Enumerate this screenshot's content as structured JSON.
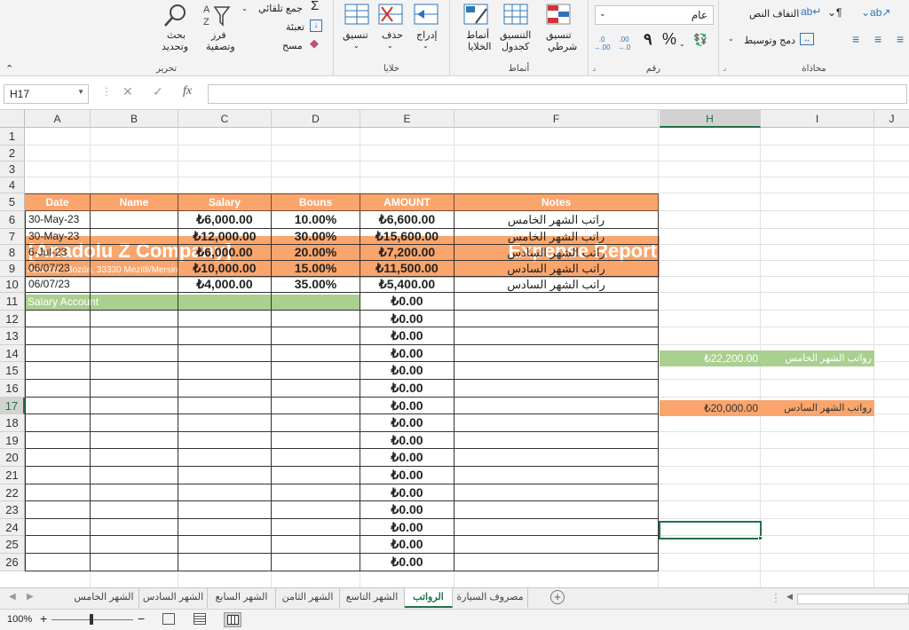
{
  "ribbon": {
    "editing": {
      "title": "تحرير",
      "autosum": "جمع تلقائي",
      "fill": "تعبئة",
      "clear": "مسح",
      "sort_filter_1": "فرز",
      "sort_filter_2": "وتصفية",
      "find_1": "بحث",
      "find_2": "وتحديد"
    },
    "cells": {
      "title": "خلايا",
      "format": "تنسيق",
      "delete": "حذف",
      "insert": "إدراج"
    },
    "styles": {
      "title": "أنماط",
      "cell_styles_1": "أنماط",
      "cell_styles_2": "الخلايا",
      "format_table_1": "التنسيق",
      "format_table_2": "كجدول",
      "conditional_1": "تنسيق",
      "conditional_2": "شرطي"
    },
    "number": {
      "title": "رقم",
      "format_value": "عام",
      "percent": "%",
      "comma": "٩",
      "inc_dec": ".00 →.0",
      "dec_dec": ".0 →.00"
    },
    "alignment": {
      "title": "محاذاة",
      "wrap": "التفاف النص",
      "merge": "دمج وتوسيط"
    }
  },
  "formula_bar": {
    "name_box": "H17",
    "fx": "fx",
    "value": ""
  },
  "columns": [
    "A",
    "B",
    "C",
    "D",
    "E",
    "F",
    "H",
    "I",
    "J"
  ],
  "rows": [
    "1",
    "2",
    "3",
    "4",
    "5",
    "6",
    "7",
    "8",
    "9",
    "10",
    "11",
    "12",
    "13",
    "14",
    "15",
    "16",
    "17",
    "18",
    "19",
    "20",
    "21",
    "22",
    "23",
    "24",
    "25",
    "26"
  ],
  "sheet": {
    "company": "[Anadolu Z Company]",
    "report_title": "Expense Report",
    "address_label": "Address:",
    "address": "Bozön, 33330 Mezitli/Mersin",
    "section": "Salary Account",
    "headers": [
      "Date",
      "Name",
      "Salary",
      "Bouns",
      "AMOUNT",
      "Notes"
    ],
    "data_rows": [
      {
        "date": "30-May-23",
        "name": "",
        "salary": "₺6,000.00",
        "bonus": "10.00%",
        "amount": "₺6,600.00",
        "notes": "راتب الشهر الخامس"
      },
      {
        "date": "30-May-23",
        "name": "",
        "salary": "₺12,000.00",
        "bonus": "30.00%",
        "amount": "₺15,600.00",
        "notes": "راتب الشهر الخامس"
      },
      {
        "date": "6-Jul-23",
        "name": "",
        "salary": "₺6,000.00",
        "bonus": "20.00%",
        "amount": "₺7,200.00",
        "notes": "راتب الشهر السادس"
      },
      {
        "date": "06/07/23",
        "name": "",
        "salary": "₺10,000.00",
        "bonus": "15.00%",
        "amount": "₺11,500.00",
        "notes": "راتب الشهر السادس"
      },
      {
        "date": "06/07/23",
        "name": "",
        "salary": "₺4,000.00",
        "bonus": "35.00%",
        "amount": "₺5,400.00",
        "notes": "راتب الشهر السادس"
      }
    ],
    "empty_amount": "₺0.00",
    "summary": [
      {
        "value": "₺22,200.00",
        "label": "رواتب الشهر الخامس",
        "color": "#a9d08e"
      },
      {
        "value": "₺20,000.00",
        "label": "رواتب الشهر السادس",
        "color": "#f9a56c"
      }
    ]
  },
  "tabs": [
    "الشهر الخامس",
    "الشهر السادس",
    "الشهر السابع",
    "الشهر الثامن",
    "الشهر التاسع",
    "الرواتب",
    "مصروف السيارة"
  ],
  "active_tab": "الرواتب",
  "status": {
    "zoom": "100%"
  },
  "colors": {
    "accent": "#217346",
    "orange": "#f9a56c",
    "green": "#a9d08e"
  }
}
